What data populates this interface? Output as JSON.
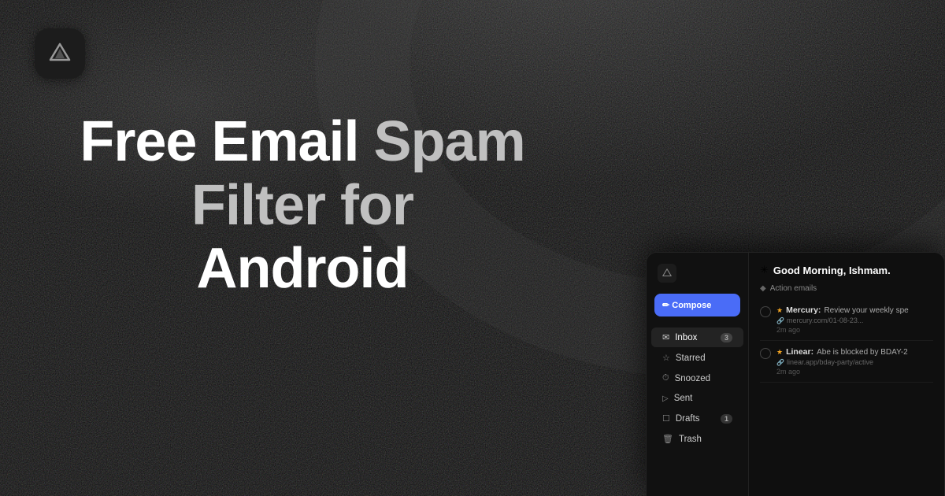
{
  "app": {
    "title": "Free Email Spam Filter for Android"
  },
  "logo": {
    "alt": "App logo"
  },
  "headline": {
    "line1": "Free Email Spam Filter for",
    "line2": "Android"
  },
  "mockup": {
    "sidebar": {
      "compose_label": "✏ Compose",
      "nav_items": [
        {
          "icon": "✉",
          "label": "Inbox",
          "badge": "3",
          "active": true
        },
        {
          "icon": "☆",
          "label": "Starred",
          "badge": "",
          "active": false
        },
        {
          "icon": "⏱",
          "label": "Snoozed",
          "badge": "",
          "active": false
        },
        {
          "icon": "➤",
          "label": "Sent",
          "badge": "",
          "active": false
        },
        {
          "icon": "☐",
          "label": "Drafts",
          "badge": "1",
          "active": false
        },
        {
          "icon": "🗑",
          "label": "Trash",
          "badge": "",
          "active": false
        }
      ]
    },
    "main": {
      "greeting": "Good Morning, Ishmam.",
      "greeting_icon": "✳",
      "section_label": "Action emails",
      "section_icon": "◆",
      "emails": [
        {
          "sender": "Mercury:",
          "subject": "Review your weekly spe",
          "link": "mercury.com/01-08-23...",
          "time": "2m ago",
          "starred": true
        },
        {
          "sender": "Linear:",
          "subject": "Abe is blocked by BDAY-2",
          "link": "linear.app/bday-party/active",
          "time": "2m ago",
          "starred": true
        }
      ]
    }
  },
  "colors": {
    "background": "#0a0a0a",
    "sidebar_bg": "#111111",
    "main_bg": "#0f0f0f",
    "compose_btn": "#4a6cf7",
    "accent_text": "#c0c0c0"
  }
}
